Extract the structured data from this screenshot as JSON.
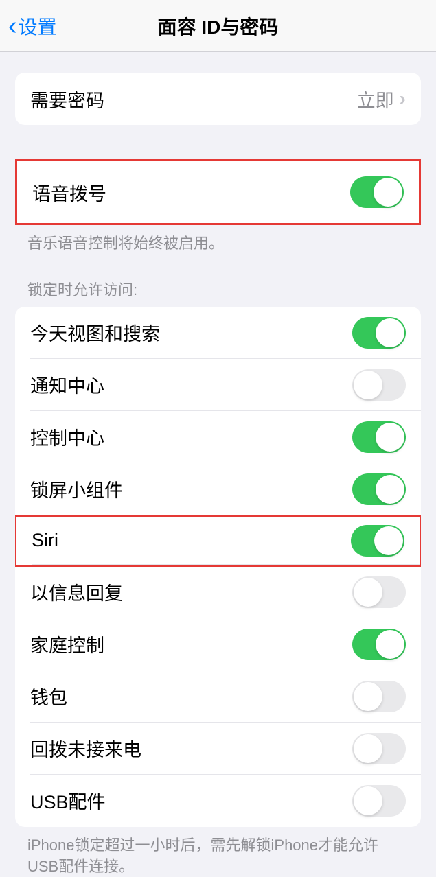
{
  "nav": {
    "back_label": "设置",
    "title": "面容 ID与密码"
  },
  "require_passcode": {
    "label": "需要密码",
    "value": "立即"
  },
  "voice_dial": {
    "label": "语音拨号",
    "footer": "音乐语音控制将始终被启用。"
  },
  "lock_access": {
    "header": "锁定时允许访问:",
    "items": [
      {
        "label": "今天视图和搜索",
        "on": true
      },
      {
        "label": "通知中心",
        "on": false
      },
      {
        "label": "控制中心",
        "on": true
      },
      {
        "label": "锁屏小组件",
        "on": true
      },
      {
        "label": "Siri",
        "on": true
      },
      {
        "label": "以信息回复",
        "on": false
      },
      {
        "label": "家庭控制",
        "on": true
      },
      {
        "label": "钱包",
        "on": false
      },
      {
        "label": "回拨未接来电",
        "on": false
      },
      {
        "label": "USB配件",
        "on": false
      }
    ],
    "footer": "iPhone锁定超过一小时后，需先解锁iPhone才能允许USB配件连接。"
  }
}
